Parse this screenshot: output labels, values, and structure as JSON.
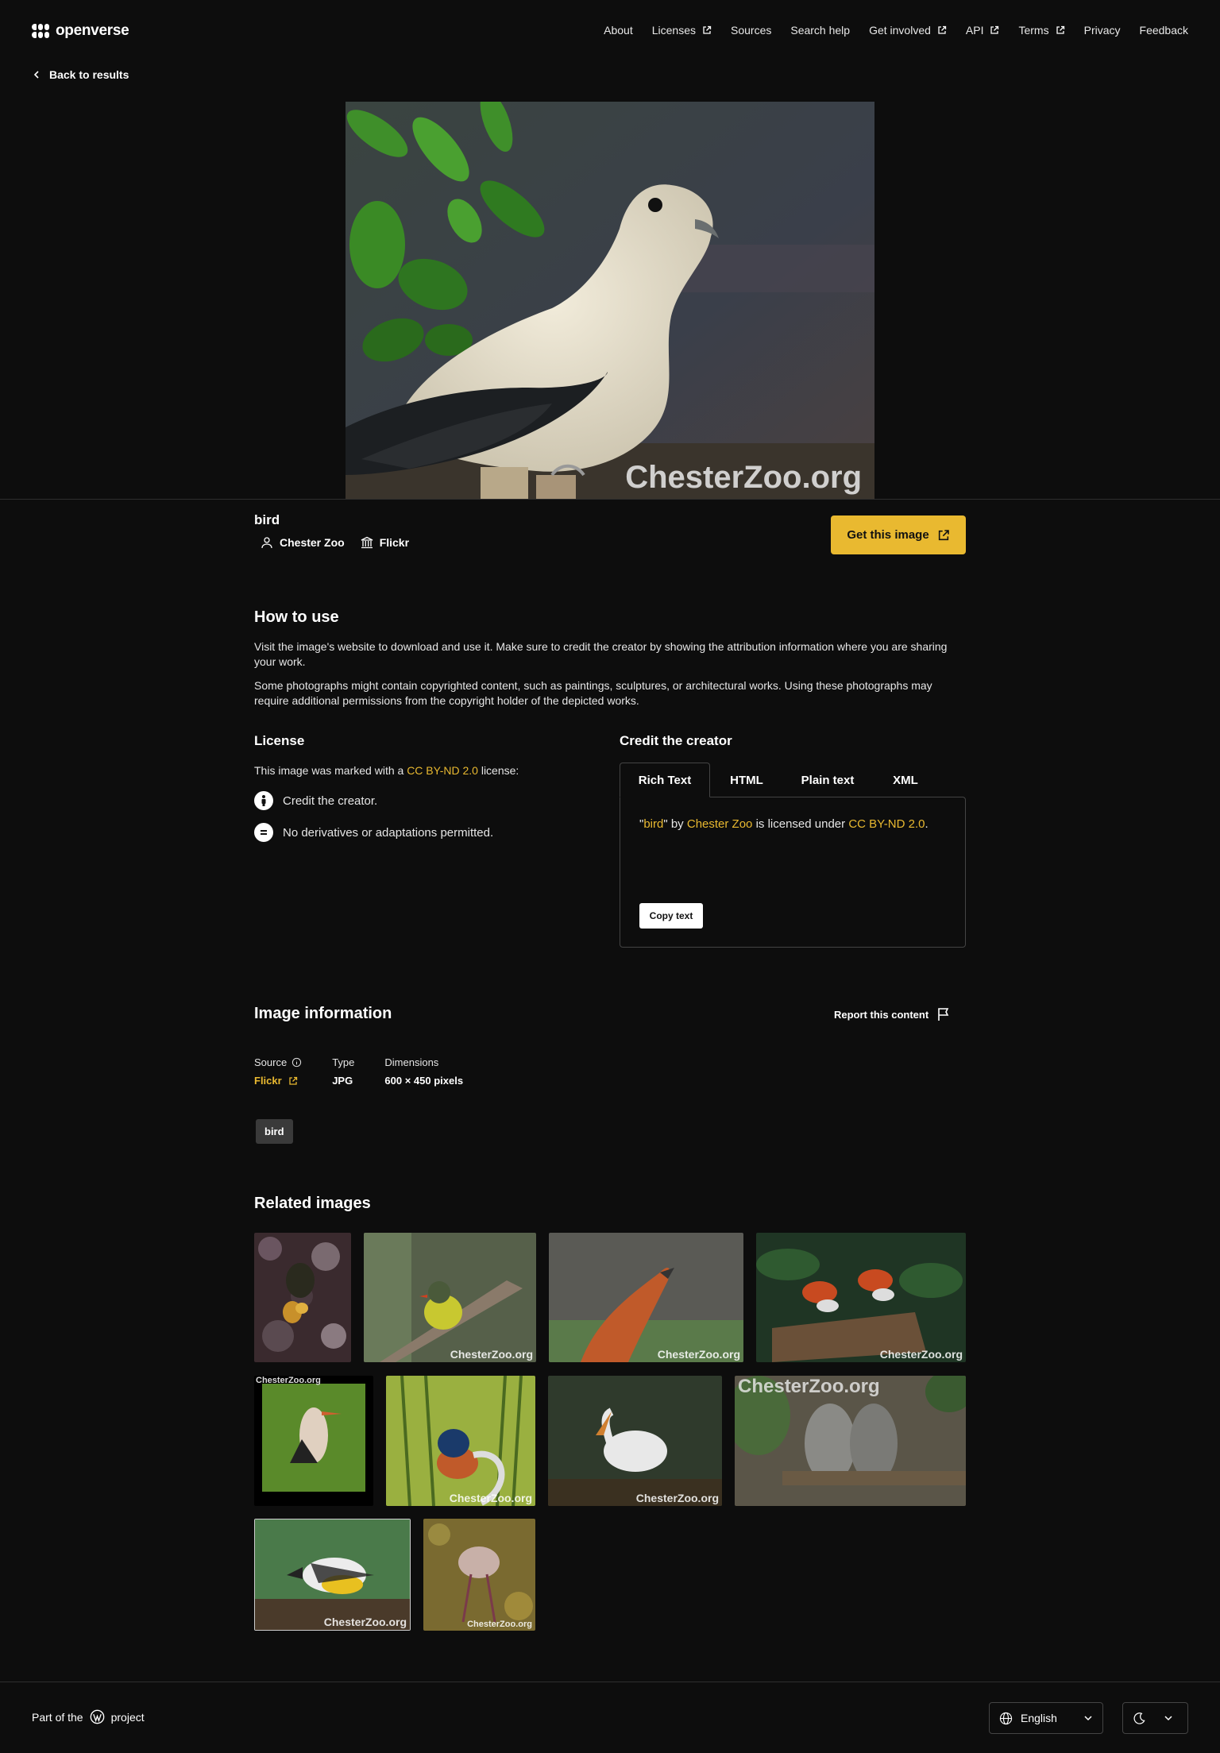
{
  "header": {
    "logo_text": "openverse",
    "nav": [
      {
        "label": "About",
        "external": false
      },
      {
        "label": "Licenses",
        "external": true
      },
      {
        "label": "Sources",
        "external": false
      },
      {
        "label": "Search help",
        "external": false
      },
      {
        "label": "Get involved",
        "external": true
      },
      {
        "label": "API",
        "external": true
      },
      {
        "label": "Terms",
        "external": true
      },
      {
        "label": "Privacy",
        "external": false
      },
      {
        "label": "Feedback",
        "external": false
      }
    ]
  },
  "back_link": "Back to results",
  "hero": {
    "watermark": "ChesterZoo.org"
  },
  "image": {
    "title": "bird",
    "creator": "Chester Zoo",
    "source": "Flickr",
    "get_button": "Get this image"
  },
  "how_to_use": {
    "title": "How to use",
    "p1": "Visit the image's website to download and use it. Make sure to credit the creator by showing the attribution information where you are sharing your work.",
    "p2": "Some photographs might contain copyrighted content, such as paintings, sculptures, or architectural works. Using these photographs may require additional permissions from the copyright holder of the depicted works."
  },
  "license": {
    "title": "License",
    "text_before": "This image was marked with a ",
    "license_name": "CC BY-ND 2.0",
    "text_after": " license:",
    "items": [
      {
        "icon": "attribution-icon",
        "text": "Credit the creator."
      },
      {
        "icon": "no-derivatives-icon",
        "text": "No derivatives or adaptations permitted."
      }
    ]
  },
  "credit": {
    "title": "Credit the creator",
    "tabs": [
      "Rich Text",
      "HTML",
      "Plain text",
      "XML"
    ],
    "active_tab": "Rich Text",
    "q_open": "\"",
    "work": "bird",
    "q_close": "\"",
    "by": " by ",
    "creator": "Chester Zoo",
    "licensed": " is licensed under ",
    "license": "CC BY-ND 2.0",
    "period": ".",
    "copy_button": "Copy text"
  },
  "info": {
    "title": "Image information",
    "report": "Report this content",
    "source_label": "Source",
    "source_value": "Flickr",
    "type_label": "Type",
    "type_value": "JPG",
    "dims_label": "Dimensions",
    "dims_value": "600 × 450 pixels",
    "tags": [
      "bird"
    ]
  },
  "related": {
    "title": "Related images",
    "watermark": "ChesterZoo.org"
  },
  "footer": {
    "part_of": "Part of the",
    "project": "project",
    "language": "English"
  },
  "colors": {
    "accent": "#e9b930",
    "background": "#0d0d0d"
  }
}
